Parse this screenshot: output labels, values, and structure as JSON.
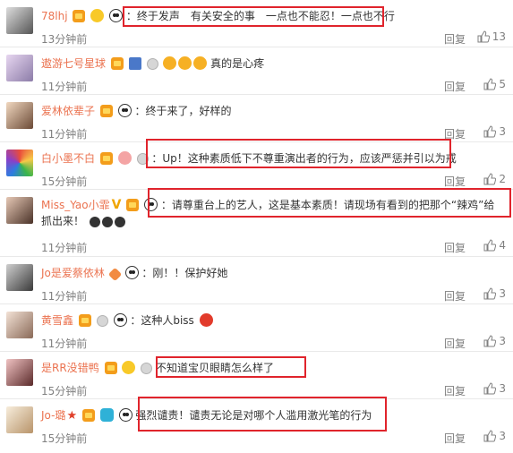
{
  "comments": [
    {
      "username": "78lhj",
      "text": "：终于发声　有关安全的事　一点也不能忍！一点也不行",
      "time": "13分钟前",
      "reply": "回复",
      "likes": "13"
    },
    {
      "username": "遨游七号星球",
      "text": "真的是心疼",
      "time": "11分钟前",
      "reply": "回复",
      "likes": "5"
    },
    {
      "username": "爱林依辈子",
      "text": "：终于来了，好样的",
      "time": "11分钟前",
      "reply": "回复",
      "likes": "3"
    },
    {
      "username": "白小墨不白",
      "text": "：Up！这种素质低下不尊重演出者的行为，应该严惩并引以为戒",
      "time": "15分钟前",
      "reply": "回复",
      "likes": "2"
    },
    {
      "username": "Miss_Yao小霏",
      "text": "：请尊重台上的艺人，这是基本素质！请现场有看到的把那个“辣鸡”给抓出来！",
      "time": "11分钟前",
      "reply": "回复",
      "likes": "4"
    },
    {
      "username": "Jo是爱蔡依林",
      "text": "：刚！！保护好她",
      "time": "11分钟前",
      "reply": "回复",
      "likes": "3"
    },
    {
      "username": "黄雪鑫",
      "text": "：这种人biss",
      "time": "11分钟前",
      "reply": "回复",
      "likes": "3"
    },
    {
      "username": "是RR没错鸭",
      "text": "不知道宝贝眼睛怎么样了",
      "time": "15分钟前",
      "reply": "回复",
      "likes": "3"
    },
    {
      "username": "Jo-璐",
      "text": "强烈谴责！谴责无论是对哪个人滥用激光笔的行为",
      "time": "15分钟前",
      "reply": "回复",
      "likes": "3"
    }
  ],
  "colors": {
    "username": "#eb7350",
    "highlight": "#e0242c",
    "meta": "#808080"
  }
}
